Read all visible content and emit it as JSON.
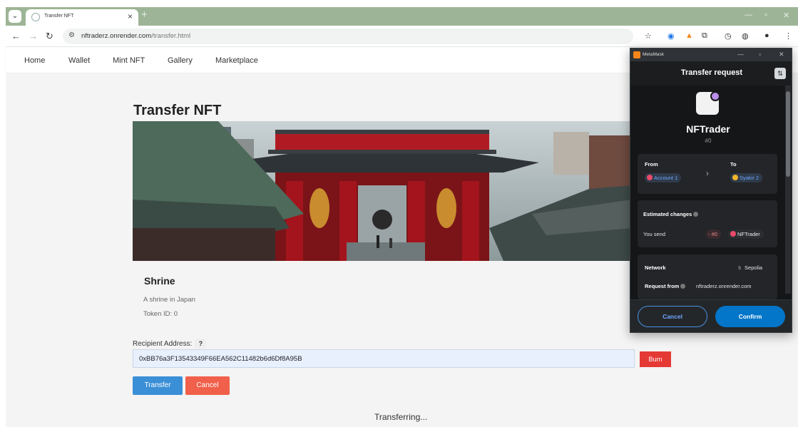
{
  "browser": {
    "tab_title": "Transfer NFT",
    "tab_close": "×",
    "new_tab": "+",
    "url_host": "nftraderz.onrender.com",
    "url_path": "/transfer.html"
  },
  "site_nav": {
    "items": [
      "Home",
      "Wallet",
      "Mint NFT",
      "Gallery",
      "Marketplace"
    ]
  },
  "page": {
    "title": "Transfer NFT",
    "nft": {
      "name": "Shrine",
      "description": "A shrine in Japan",
      "token_id": "Token ID: 0"
    },
    "recipient_label": "Recipient Address:",
    "help_label": "?",
    "recipient_value": "0xBB76a3F13543349F66EA562C11482b6d6Df8A95B",
    "burn_label": "Burn",
    "transfer_label": "Transfer",
    "cancel_label": "Cancel",
    "status_text": "Transferring..."
  },
  "metamask": {
    "app_name": "MetaMask",
    "header_title": "Transfer request",
    "nft_name": "NFTrader",
    "nft_id": "#0",
    "from_label": "From",
    "to_label": "To",
    "from_account": "Account 1",
    "to_account": "Syakir 2",
    "estimated_label": "Estimated changes",
    "you_send_label": "You send",
    "send_amount": "- #0",
    "send_token": "NFTrader",
    "network_label": "Network",
    "network_value": "Sepolia",
    "network_badge": "S",
    "request_from_label": "Request from",
    "request_from_value": "nftraderz.onrender.com",
    "cancel_label": "Cancel",
    "confirm_label": "Confirm"
  },
  "colors": {
    "browser_frame": "#9db596",
    "primary_blue": "#3b8fd6",
    "cancel_red": "#f0604a",
    "burn_red": "#e53935",
    "mm_confirm": "#0376c9"
  }
}
